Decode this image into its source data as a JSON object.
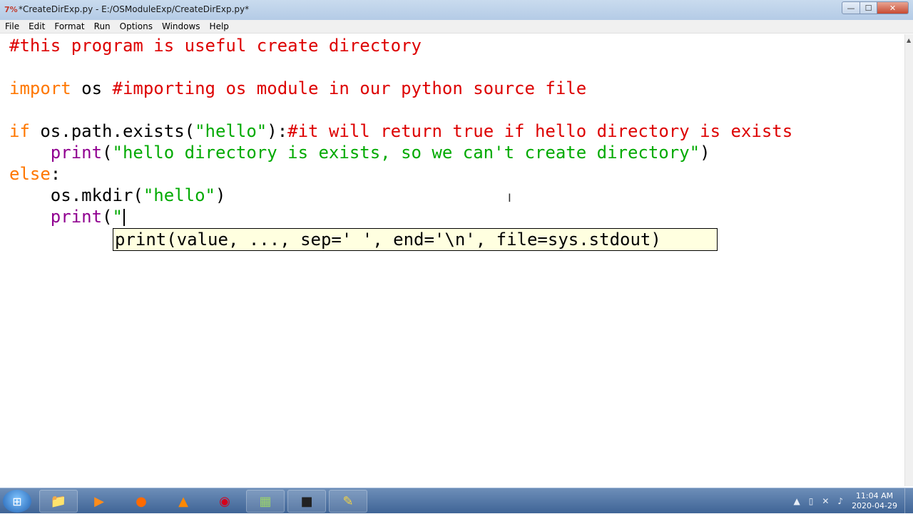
{
  "window": {
    "app_icon": "7%",
    "title": "*CreateDirExp.py - E:/OSModuleExp/CreateDirExp.py*",
    "controls": {
      "minimize": "—",
      "maximize": "☐",
      "close": "✕"
    }
  },
  "menu": [
    "File",
    "Edit",
    "Format",
    "Run",
    "Options",
    "Windows",
    "Help"
  ],
  "code": {
    "line1": {
      "comment": "#this program is useful create directory"
    },
    "line3": {
      "kw": "import",
      "plain": " os ",
      "comment": "#importing os module in our python source file"
    },
    "line5": {
      "kw": "if",
      "plain1": " os.path.exists(",
      "str": "\"hello\"",
      "plain2": "):",
      "comment": "#it will return true if hello directory is exists"
    },
    "line6": {
      "indent": "    ",
      "builtin": "print",
      "plain1": "(",
      "str": "\"hello directory is exists, so we can't create directory\"",
      "plain2": ")"
    },
    "line7": {
      "kw": "else",
      "plain": ":"
    },
    "line8": {
      "indent": "    ",
      "plain1": "os.mkdir(",
      "str": "\"hello\"",
      "plain2": ")"
    },
    "line9": {
      "indent": "    ",
      "builtin": "print",
      "plain1": "(",
      "str": "\""
    }
  },
  "calltip": "print(value, ..., sep=' ', end='\\n', file=sys.stdout)",
  "taskbar": {
    "apps": [
      {
        "name": "folder",
        "glyph": "📁",
        "color": "#f5c542"
      },
      {
        "name": "media-player",
        "glyph": "▶",
        "color": "#ff8c1a"
      },
      {
        "name": "firefox",
        "glyph": "●",
        "color": "#ff6a00"
      },
      {
        "name": "vlc",
        "glyph": "▲",
        "color": "#ff8800"
      },
      {
        "name": "opera",
        "glyph": "◉",
        "color": "#d6001c"
      },
      {
        "name": "notes",
        "glyph": "▦",
        "color": "#9bd36a"
      },
      {
        "name": "video-recorder",
        "glyph": "■",
        "color": "#222222"
      },
      {
        "name": "python",
        "glyph": "✎",
        "color": "#f5d442"
      }
    ],
    "clock_time": "11:04 AM",
    "clock_date": "2020-04-29"
  }
}
